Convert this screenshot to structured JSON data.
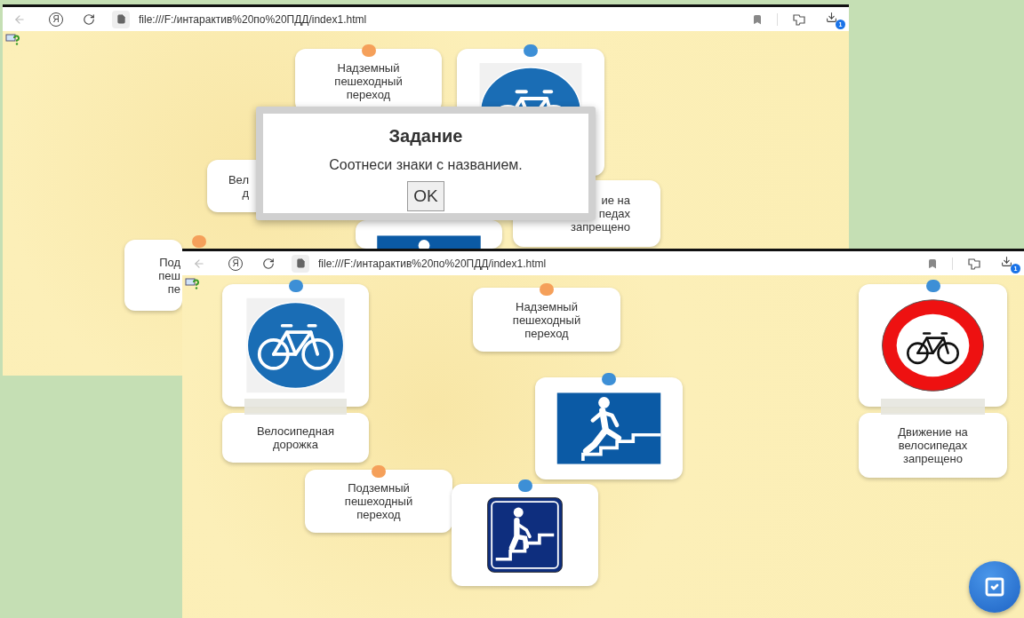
{
  "windows": [
    {
      "toolbar": {
        "logo": "Я",
        "address": "file:///F:/интарактив%20по%20ПДД/index1.html",
        "downloads_badge": "1"
      },
      "cards": [
        {
          "kind": "label",
          "lines": [
            "Надземный",
            "пешеходный",
            "переход"
          ],
          "color": "#f5a05a",
          "taped": false
        },
        {
          "kind": "bike-path-sign",
          "color": "#3d8fd6"
        },
        {
          "kind": "label",
          "lines": [
            "Вел",
            "д"
          ],
          "taped": false
        },
        {
          "kind": "underpass-sign"
        },
        {
          "kind": "label",
          "lines": [
            "ие на",
            "педах",
            "запрещено"
          ],
          "taped": false
        },
        {
          "kind": "label",
          "lines": [
            "Под",
            "пеш",
            "пе"
          ],
          "color": "#f5a05a",
          "taped": false
        }
      ],
      "dialog": {
        "title": "Задание",
        "message": "Соотнеси знаки с названием.",
        "button": "OK"
      }
    },
    {
      "toolbar": {
        "logo": "Я",
        "address": "file:///F:/интарактив%20по%20ПДД/index1.html",
        "downloads_badge": "1"
      },
      "cards": [
        {
          "kind": "bike-path-sign",
          "color": "#3d8fd6"
        },
        {
          "kind": "label",
          "lines": [
            "Велосипедная",
            "дорожка"
          ],
          "taped": true
        },
        {
          "kind": "label",
          "lines": [
            "Надземный",
            "пешеходный",
            "переход"
          ],
          "color": "#f5a05a",
          "taped": false
        },
        {
          "kind": "no-bicycles-sign",
          "color": "#3d8fd6"
        },
        {
          "kind": "label",
          "lines": [
            "Движение на",
            "велосипедах",
            "запрещено"
          ],
          "taped": true
        },
        {
          "kind": "underpass-sign",
          "color": "#3d8fd6"
        },
        {
          "kind": "label",
          "lines": [
            "Подземный",
            "пешеходный",
            "переход"
          ],
          "color": "#f5a05a",
          "taped": false
        },
        {
          "kind": "stairs-sign",
          "color": "#3d8fd6"
        }
      ],
      "floating_actions": [
        {
          "kind": "check"
        }
      ]
    }
  ]
}
